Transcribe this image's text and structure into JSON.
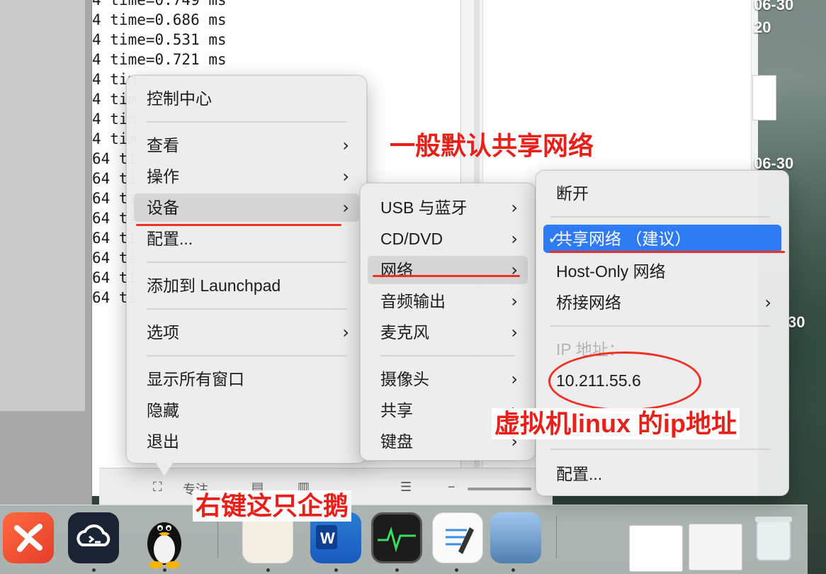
{
  "terminal": {
    "lines": [
      "4 time=0.749 ms",
      "4 time=0.686 ms",
      "4 time=0.531 ms",
      "4 time=0.721 ms",
      "4 tim",
      "4 tim",
      "4 tim",
      "4 tim",
      "64 ti",
      "64 ti",
      "64 ti",
      "64 ti",
      "64 ti",
      "64 ti",
      "64 ti",
      "64 ti"
    ]
  },
  "desktop": {
    "dates": [
      "06-30",
      "20",
      "06-30",
      "30"
    ]
  },
  "toolbar": {
    "focus_label": "专注"
  },
  "context_menu": {
    "items": {
      "control_center": "控制中心",
      "view": "查看",
      "actions": "操作",
      "devices": "设备",
      "configure": "配置...",
      "add_launchpad": "添加到 Launchpad",
      "options": "选项",
      "show_all_windows": "显示所有窗口",
      "hide": "隐藏",
      "quit": "退出"
    }
  },
  "devices_menu": {
    "items": {
      "usb_bluetooth": "USB 与蓝牙",
      "cd_dvd": "CD/DVD",
      "network": "网络",
      "audio_output": "音频输出",
      "microphone": "麦克风",
      "camera": "摄像头",
      "sharing": "共享",
      "keyboard": "键盘"
    }
  },
  "network_menu": {
    "items": {
      "disconnect": "断开",
      "shared_network": "共享网络 （建议）",
      "host_only": "Host-Only 网络",
      "bridged": "桥接网络",
      "ip_label": "IP 地址：",
      "ip_value": "10.211.55.6",
      "configure": "配置..."
    },
    "check_mark": "✓"
  },
  "annotations": {
    "default_shared": "一般默认共享网络",
    "vm_ip": "虚拟机linux 的ip地址",
    "right_click_penguin": "右键这只企鹅"
  },
  "colors": {
    "annotation_red": "#e8201a",
    "selection_blue": "#2f7bf5"
  },
  "icons": {
    "menu_chevron": "›"
  }
}
